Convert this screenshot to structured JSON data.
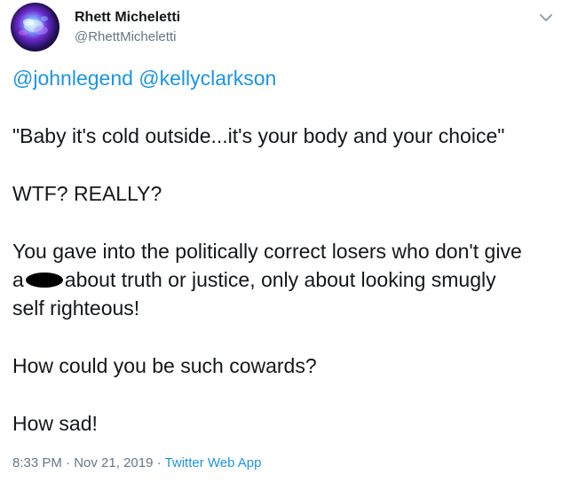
{
  "user": {
    "name": "Rhett Micheletti",
    "handle": "@RhettMicheletti"
  },
  "tweet": {
    "mentions": [
      "@johnlegend",
      "@kellyclarkson"
    ],
    "quote": "\"Baby it's cold outside...it's your body and your choice\"",
    "exclamation": "WTF?  REALLY?",
    "para3_line1": "You gave into the politically correct losers who don't give",
    "para3_line2_start": "a",
    "para3_line2_end": "about truth or justice, only about looking smugly",
    "para3_line3": "self righteous!",
    "question": "How could you be such cowards?",
    "closing": "How sad!"
  },
  "meta": {
    "time": "8:33 PM",
    "separator": "·",
    "date": "Nov 21, 2019",
    "app": "Twitter Web App"
  },
  "colors": {
    "link": "#1b95e0",
    "secondary_text": "#657786",
    "primary_text": "#14171a"
  },
  "icons": {
    "menu": "chevron-down-icon"
  }
}
